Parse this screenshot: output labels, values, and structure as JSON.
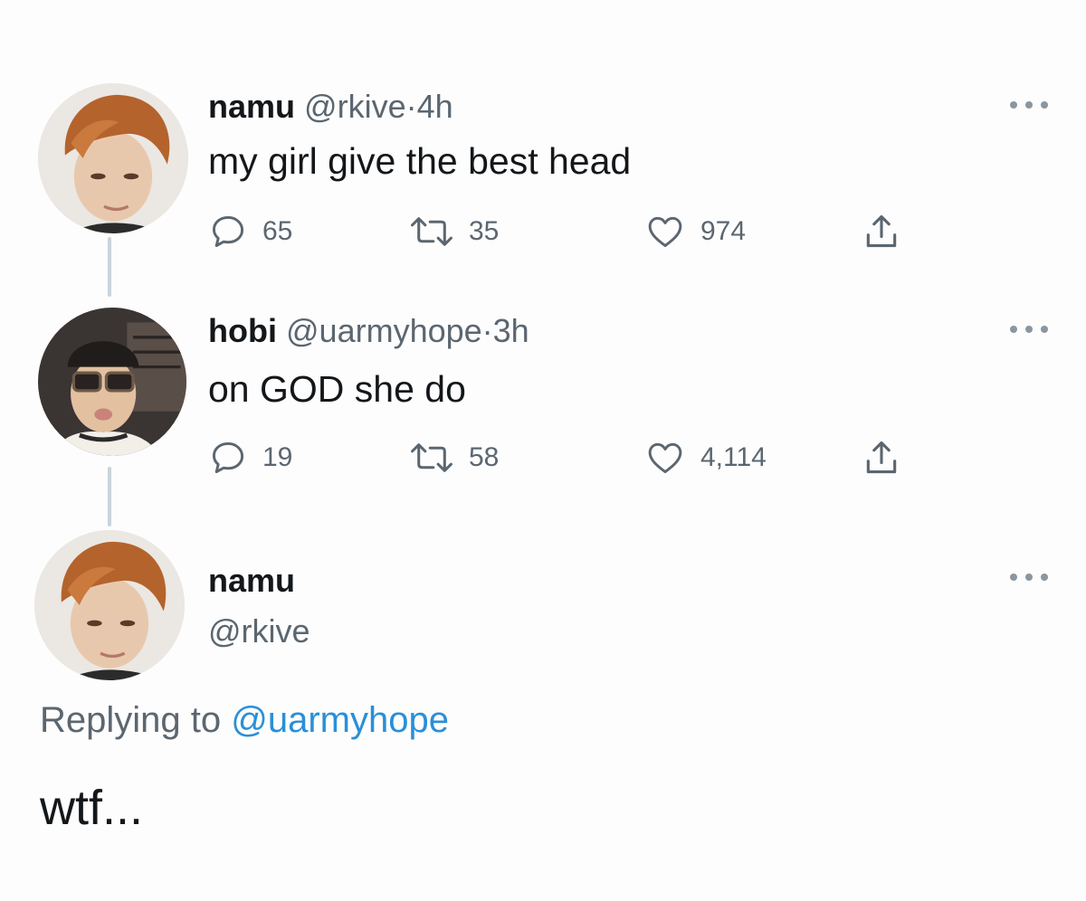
{
  "thread": {
    "tweets": [
      {
        "name": "namu",
        "handle": "@rkive",
        "separator": "·",
        "time": "4h",
        "text": "my girl give the best head",
        "reply_count": "65",
        "retweet_count": "35",
        "like_count": "974"
      },
      {
        "name": "hobi",
        "handle": "@uarmyhope",
        "separator": "·",
        "time": "3h",
        "text": "on GOD she do",
        "reply_count": "19",
        "retweet_count": "58",
        "like_count": "4,114"
      }
    ],
    "focused_tweet": {
      "name": "namu",
      "handle": "@rkive",
      "replying_label": "Replying to",
      "replying_mention": "@uarmyhope",
      "text": "wtf..."
    }
  },
  "icons": {
    "reply": "speech-bubble-icon",
    "retweet": "retweet-icon",
    "like": "heart-icon",
    "share": "share-icon",
    "more": "more-dots-icon"
  },
  "colors": {
    "text_primary": "#14171a",
    "text_secondary": "#5b6670",
    "mention": "#2a8fd8",
    "thread_line": "#c9d3db"
  }
}
